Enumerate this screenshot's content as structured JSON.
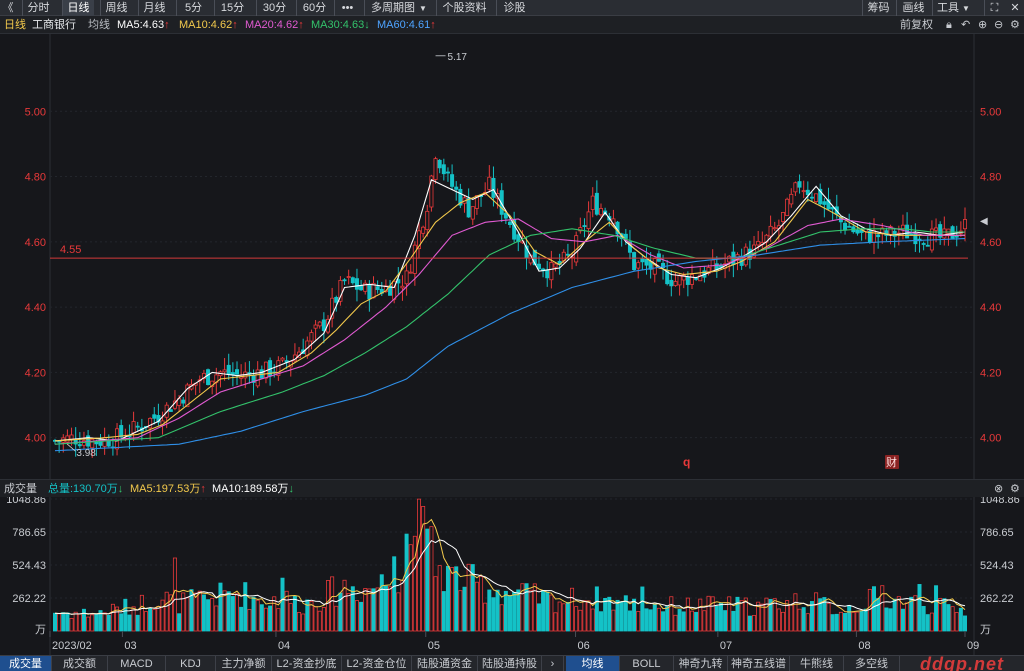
{
  "toolbar": {
    "back": "《",
    "tabs": [
      {
        "label": "分时",
        "active": false
      },
      {
        "label": "日线",
        "active": true
      },
      {
        "label": "周线",
        "active": false
      },
      {
        "label": "月线",
        "active": false
      },
      {
        "label": "5分",
        "active": false
      },
      {
        "label": "15分",
        "active": false
      },
      {
        "label": "30分",
        "active": false
      },
      {
        "label": "60分",
        "active": false
      }
    ],
    "more": "•••",
    "multi_period": "多周期图",
    "stock_info": "个股资料",
    "diagnose": "诊股",
    "right": {
      "chips": "筹码",
      "draw": "画线",
      "tools": "工具"
    }
  },
  "info": {
    "period": "日线",
    "stock_name": "工商银行",
    "ma_label": "均线",
    "ma": [
      {
        "text": "MA5:4.63",
        "arrow": "↑",
        "color": "#ffffff"
      },
      {
        "text": "MA10:4.62",
        "arrow": "↑",
        "color": "#f2c94c"
      },
      {
        "text": "MA20:4.62",
        "arrow": "↑",
        "color": "#e05ad1"
      },
      {
        "text": "MA30:4.63",
        "arrow": "↓",
        "color": "#33c26b"
      },
      {
        "text": "MA60:4.61",
        "arrow": "↑",
        "color": "#4ea3ff"
      }
    ],
    "adjust": "前复权"
  },
  "colors": {
    "up": "#e8393a",
    "down": "#14c2c7",
    "ma5": "#ffffff",
    "ma10": "#f2c94c",
    "ma20": "#e05ad1",
    "ma30": "#33c26b",
    "ma60": "#2f8fe8",
    "support": "#d33a3a"
  },
  "chart_data": [
    {
      "type": "candlestick",
      "title": "日线 工商银行",
      "y_ticks": [
        "5.00",
        "4.80",
        "4.60",
        "4.40",
        "4.20",
        "4.00"
      ],
      "ylim": [
        3.95,
        5.2
      ],
      "annotations": {
        "high_label": "5.17",
        "low_label": "3.98",
        "support_label": "4.55",
        "support_value": 4.55,
        "marker_q": "q",
        "marker_cai": "财"
      },
      "x_ticks": [
        "2023/02",
        "03",
        "04",
        "05",
        "06",
        "07",
        "08",
        "09"
      ],
      "ohlc_anchors": [
        [
          0,
          3.99
        ],
        [
          5,
          4.0
        ],
        [
          10,
          3.99
        ],
        [
          15,
          4.0
        ],
        [
          20,
          4.03
        ],
        [
          25,
          4.07
        ],
        [
          30,
          4.12
        ],
        [
          35,
          4.18
        ],
        [
          40,
          4.2
        ],
        [
          45,
          4.19
        ],
        [
          50,
          4.2
        ],
        [
          55,
          4.22
        ],
        [
          60,
          4.28
        ],
        [
          65,
          4.35
        ],
        [
          70,
          4.48
        ],
        [
          75,
          4.45
        ],
        [
          80,
          4.46
        ],
        [
          85,
          4.49
        ],
        [
          90,
          4.72
        ],
        [
          92,
          4.88
        ],
        [
          95,
          4.79
        ],
        [
          100,
          4.7
        ],
        [
          105,
          4.77
        ],
        [
          110,
          4.66
        ],
        [
          115,
          4.55
        ],
        [
          120,
          4.51
        ],
        [
          125,
          4.56
        ],
        [
          130,
          4.72
        ],
        [
          135,
          4.68
        ],
        [
          140,
          4.53
        ],
        [
          145,
          4.52
        ],
        [
          150,
          4.48
        ],
        [
          155,
          4.5
        ],
        [
          160,
          4.52
        ],
        [
          165,
          4.55
        ],
        [
          170,
          4.58
        ],
        [
          175,
          4.65
        ],
        [
          180,
          4.78
        ],
        [
          185,
          4.73
        ],
        [
          190,
          4.66
        ],
        [
          195,
          4.62
        ],
        [
          200,
          4.62
        ],
        [
          205,
          4.63
        ],
        [
          210,
          4.62
        ],
        [
          215,
          4.61
        ],
        [
          220,
          4.65
        ]
      ],
      "ma_anchors": {
        "ma5": [
          [
            0,
            3.99
          ],
          [
            8,
            4.0
          ],
          [
            15,
            3.99
          ],
          [
            20,
            4.02
          ],
          [
            25,
            4.05
          ],
          [
            32,
            4.15
          ],
          [
            38,
            4.2
          ],
          [
            44,
            4.19
          ],
          [
            50,
            4.2
          ],
          [
            58,
            4.24
          ],
          [
            65,
            4.32
          ],
          [
            70,
            4.46
          ],
          [
            76,
            4.47
          ],
          [
            82,
            4.46
          ],
          [
            87,
            4.62
          ],
          [
            91,
            4.79
          ],
          [
            96,
            4.76
          ],
          [
            101,
            4.73
          ],
          [
            106,
            4.76
          ],
          [
            112,
            4.63
          ],
          [
            117,
            4.51
          ],
          [
            122,
            4.52
          ],
          [
            127,
            4.58
          ],
          [
            133,
            4.69
          ],
          [
            138,
            4.6
          ],
          [
            143,
            4.55
          ],
          [
            149,
            4.5
          ],
          [
            155,
            4.49
          ],
          [
            161,
            4.52
          ],
          [
            167,
            4.56
          ],
          [
            172,
            4.6
          ],
          [
            178,
            4.68
          ],
          [
            184,
            4.77
          ],
          [
            190,
            4.68
          ],
          [
            196,
            4.64
          ],
          [
            202,
            4.62
          ],
          [
            208,
            4.63
          ],
          [
            214,
            4.62
          ],
          [
            220,
            4.63
          ]
        ],
        "ma10": [
          [
            0,
            3.99
          ],
          [
            12,
            4.0
          ],
          [
            20,
            4.01
          ],
          [
            26,
            4.04
          ],
          [
            34,
            4.12
          ],
          [
            40,
            4.18
          ],
          [
            47,
            4.19
          ],
          [
            54,
            4.2
          ],
          [
            62,
            4.26
          ],
          [
            68,
            4.33
          ],
          [
            74,
            4.41
          ],
          [
            80,
            4.45
          ],
          [
            86,
            4.55
          ],
          [
            92,
            4.66
          ],
          [
            98,
            4.72
          ],
          [
            104,
            4.75
          ],
          [
            110,
            4.68
          ],
          [
            116,
            4.57
          ],
          [
            122,
            4.53
          ],
          [
            128,
            4.6
          ],
          [
            134,
            4.66
          ],
          [
            140,
            4.58
          ],
          [
            146,
            4.52
          ],
          [
            152,
            4.5
          ],
          [
            160,
            4.51
          ],
          [
            166,
            4.54
          ],
          [
            174,
            4.6
          ],
          [
            182,
            4.73
          ],
          [
            188,
            4.69
          ],
          [
            196,
            4.63
          ],
          [
            204,
            4.62
          ],
          [
            212,
            4.62
          ],
          [
            220,
            4.62
          ]
        ],
        "ma20": [
          [
            0,
            3.98
          ],
          [
            20,
            4.0
          ],
          [
            30,
            4.06
          ],
          [
            40,
            4.14
          ],
          [
            50,
            4.18
          ],
          [
            60,
            4.22
          ],
          [
            70,
            4.3
          ],
          [
            80,
            4.4
          ],
          [
            88,
            4.5
          ],
          [
            96,
            4.62
          ],
          [
            104,
            4.66
          ],
          [
            112,
            4.67
          ],
          [
            120,
            4.61
          ],
          [
            128,
            4.6
          ],
          [
            136,
            4.62
          ],
          [
            144,
            4.56
          ],
          [
            152,
            4.52
          ],
          [
            162,
            4.53
          ],
          [
            172,
            4.58
          ],
          [
            182,
            4.65
          ],
          [
            190,
            4.67
          ],
          [
            200,
            4.65
          ],
          [
            210,
            4.62
          ],
          [
            220,
            4.62
          ]
        ],
        "ma30": [
          [
            0,
            3.98
          ],
          [
            25,
            4.0
          ],
          [
            40,
            4.08
          ],
          [
            55,
            4.14
          ],
          [
            65,
            4.19
          ],
          [
            75,
            4.26
          ],
          [
            85,
            4.34
          ],
          [
            95,
            4.44
          ],
          [
            105,
            4.56
          ],
          [
            115,
            4.62
          ],
          [
            125,
            4.64
          ],
          [
            135,
            4.62
          ],
          [
            145,
            4.58
          ],
          [
            155,
            4.55
          ],
          [
            165,
            4.55
          ],
          [
            175,
            4.59
          ],
          [
            185,
            4.63
          ],
          [
            195,
            4.64
          ],
          [
            205,
            4.64
          ],
          [
            212,
            4.63
          ],
          [
            220,
            4.63
          ]
        ],
        "ma60": [
          [
            0,
            3.96
          ],
          [
            30,
            3.98
          ],
          [
            45,
            4.02
          ],
          [
            60,
            4.08
          ],
          [
            75,
            4.13
          ],
          [
            85,
            4.18
          ],
          [
            95,
            4.28
          ],
          [
            110,
            4.38
          ],
          [
            125,
            4.46
          ],
          [
            140,
            4.51
          ],
          [
            155,
            4.54
          ],
          [
            170,
            4.56
          ],
          [
            185,
            4.59
          ],
          [
            200,
            4.6
          ],
          [
            220,
            4.61
          ]
        ]
      }
    },
    {
      "type": "bar",
      "title": "成交量",
      "header": {
        "label": "成交量",
        "total": "总量:130.70万",
        "total_arrow": "↓",
        "ma5": "MA5:197.53万",
        "ma5_arrow": "↑",
        "ma10": "MA10:189.58万",
        "ma10_arrow": "↓"
      },
      "y_ticks": [
        "1048.86",
        "786.65",
        "524.43",
        "262.22",
        "万"
      ],
      "ylim": [
        0,
        1048.86
      ],
      "volume_anchors": [
        [
          0,
          160
        ],
        [
          10,
          150
        ],
        [
          20,
          220
        ],
        [
          25,
          300
        ],
        [
          30,
          240
        ],
        [
          40,
          300
        ],
        [
          45,
          330
        ],
        [
          50,
          250
        ],
        [
          55,
          280
        ],
        [
          60,
          230
        ],
        [
          65,
          300
        ],
        [
          70,
          380
        ],
        [
          75,
          360
        ],
        [
          80,
          420
        ],
        [
          84,
          520
        ],
        [
          86,
          700
        ],
        [
          88,
          1000
        ],
        [
          90,
          820
        ],
        [
          92,
          560
        ],
        [
          95,
          480
        ],
        [
          100,
          420
        ],
        [
          105,
          370
        ],
        [
          110,
          330
        ],
        [
          115,
          300
        ],
        [
          120,
          260
        ],
        [
          130,
          280
        ],
        [
          140,
          230
        ],
        [
          150,
          210
        ],
        [
          160,
          220
        ],
        [
          170,
          210
        ],
        [
          180,
          260
        ],
        [
          185,
          230
        ],
        [
          190,
          180
        ],
        [
          200,
          300
        ],
        [
          205,
          250
        ],
        [
          210,
          240
        ],
        [
          215,
          200
        ],
        [
          220,
          180
        ]
      ],
      "highlight_bars": {
        "29": 580,
        "82": 590,
        "85": 770,
        "88": 1048,
        "89": 990,
        "90": 810,
        "55": 420,
        "142": 350,
        "209": 370,
        "200": 360,
        "213": 360
      }
    }
  ],
  "volume_toolbar": {
    "tabs": [
      "成交量",
      "成交额",
      "MACD",
      "KDJ",
      "主力净额",
      "L2-资金抄底",
      "L2-资金仓位",
      "陆股通资金",
      "陆股通持股"
    ],
    "nav": "›",
    "tabs2": [
      "均线",
      "BOLL",
      "神奇九转",
      "神奇五线谱",
      "牛熊线",
      "多空线"
    ]
  },
  "watermark": "ddgp.net"
}
